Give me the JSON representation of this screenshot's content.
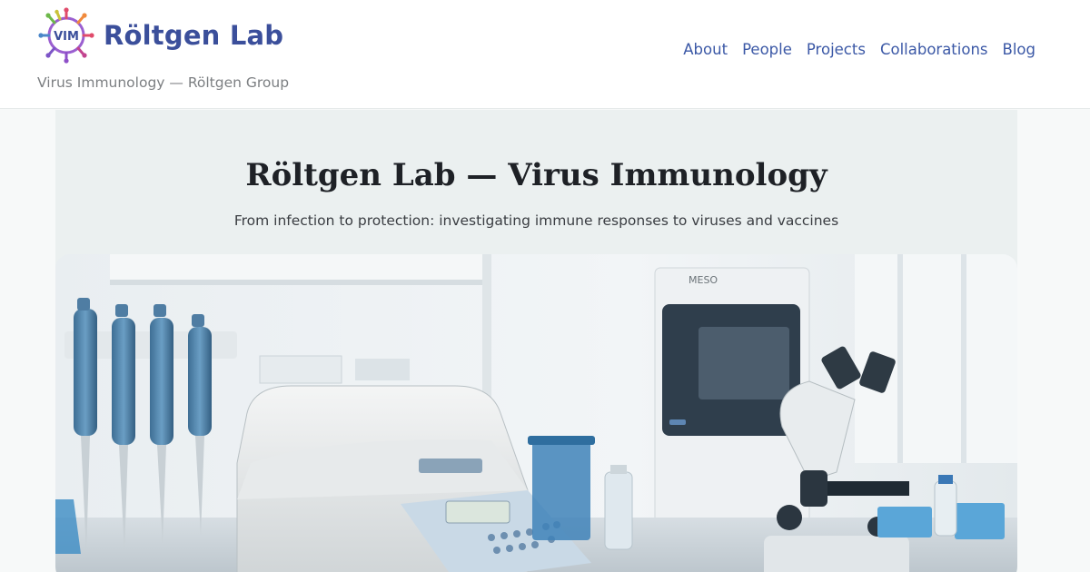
{
  "header": {
    "brand_name": "Röltgen Lab",
    "logo_text": "VIM",
    "tagline": "Virus Immunology — Röltgen Group",
    "nav": [
      {
        "label": "About"
      },
      {
        "label": "People"
      },
      {
        "label": "Projects"
      },
      {
        "label": "Collaborations"
      },
      {
        "label": "Blog"
      }
    ]
  },
  "hero": {
    "title": "Röltgen Lab — Virus Immunology",
    "subtitle": "From infection to protection: investigating immune responses to viruses and vaccines",
    "image_label": "MESO"
  },
  "colors": {
    "brand": "#3b4f9b",
    "nav_link": "#3b58a6",
    "hero_bg": "#ebf0f0"
  }
}
